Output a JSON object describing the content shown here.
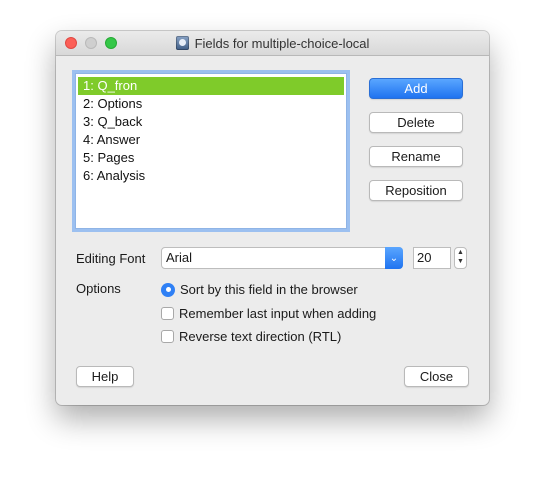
{
  "window": {
    "title": "Fields for multiple-choice-local"
  },
  "fields": [
    "1: Q_fron",
    "2: Options",
    "3: Q_back",
    "4: Answer",
    "5: Pages",
    "6: Analysis"
  ],
  "selected_index": 0,
  "buttons": {
    "add": "Add",
    "delete": "Delete",
    "rename": "Rename",
    "reposition": "Reposition",
    "help": "Help",
    "close": "Close"
  },
  "editing_font": {
    "label": "Editing Font",
    "value": "Arial",
    "size": "20"
  },
  "options": {
    "label": "Options",
    "sort": "Sort by this field in the browser",
    "remember": "Remember last input when adding",
    "rtl": "Reverse text direction (RTL)"
  },
  "colors": {
    "accent": "#2f80f5",
    "selection": "#7fcb2a"
  }
}
